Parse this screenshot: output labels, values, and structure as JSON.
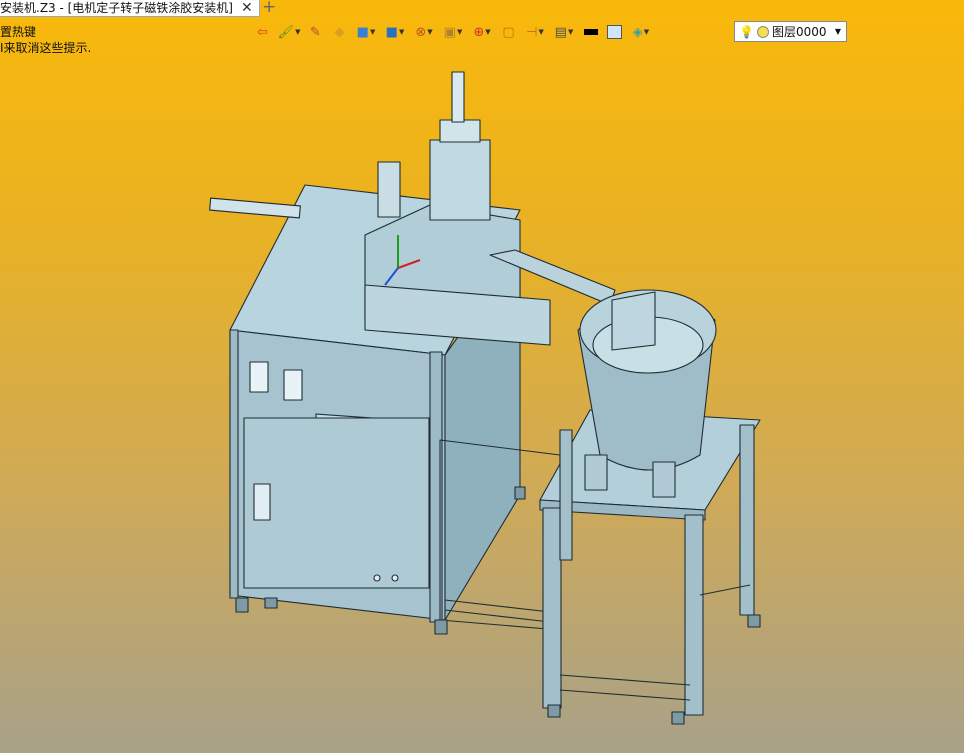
{
  "tab": {
    "title": "安装机.Z3 - [电机定子转子磁铁涂胶安装机]",
    "close_glyph": "✕",
    "add_glyph": "+"
  },
  "hints": [
    "置热键",
    "I来取消这些提示."
  ],
  "toolbar": {
    "buttons": [
      {
        "name": "exit-icon",
        "glyph": "⇦",
        "color": "#d04020"
      },
      {
        "name": "paint-icon",
        "glyph": "🖌",
        "color": "#5a8a20"
      },
      {
        "name": "pen-icon",
        "glyph": "✎",
        "color": "#c04040"
      },
      {
        "name": "solid-box-icon",
        "glyph": "◆",
        "color": "#d8a020"
      },
      {
        "name": "cube-icon",
        "glyph": "■",
        "color": "#3a80d0"
      },
      {
        "name": "multi-cube-icon",
        "glyph": "■",
        "color": "#2a70c0"
      },
      {
        "name": "wheel-icon",
        "glyph": "⊗",
        "color": "#c05020"
      },
      {
        "name": "frame-icon",
        "glyph": "▣",
        "color": "#b08030"
      },
      {
        "name": "target-icon",
        "glyph": "⊕",
        "color": "#d03030"
      },
      {
        "name": "page-icon",
        "glyph": "▢",
        "color": "#c07010"
      },
      {
        "name": "dimension-icon",
        "glyph": "⊣",
        "color": "#c07010"
      },
      {
        "name": "display-icon",
        "glyph": "▤",
        "color": "#505050"
      }
    ],
    "line_color": "#000000",
    "fill_color": "#cfe6ff"
  },
  "layer": {
    "label": "图层0000",
    "bulb_glyph": "💡",
    "arrow_glyph": "▼"
  },
  "colors": {
    "background_top": "#f9b80a",
    "background_bottom": "#a8a189",
    "model_face": "#a8c8d4",
    "model_edge": "#1f2d33"
  }
}
